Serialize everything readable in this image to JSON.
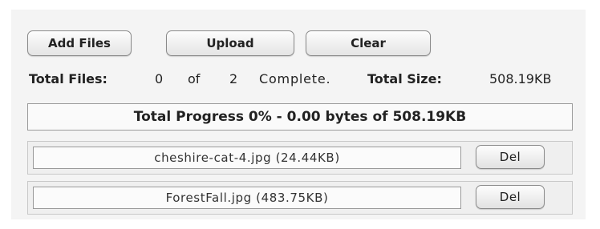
{
  "toolbar": {
    "add_files_label": "Add Files",
    "upload_label": "Upload",
    "clear_label": "Clear"
  },
  "status": {
    "total_files_label": "Total Files:",
    "completed_count": "0",
    "of_label": "of",
    "total_count": "2",
    "complete_label": "Complete.",
    "total_size_label": "Total Size:",
    "total_size_value": "508.19KB"
  },
  "progress": {
    "percent": 0,
    "label": "Total Progress 0% - 0.00 bytes of 508.19KB"
  },
  "files": [
    {
      "name": "cheshire-cat-4.jpg (24.44KB)",
      "delete_label": "Del"
    },
    {
      "name": "ForestFall.jpg (483.75KB)",
      "delete_label": "Del"
    }
  ],
  "colors": {
    "panel_background": "#f4f4f4",
    "button_border": "#8a8a8a",
    "progress_fill": "#9fc5e8"
  }
}
